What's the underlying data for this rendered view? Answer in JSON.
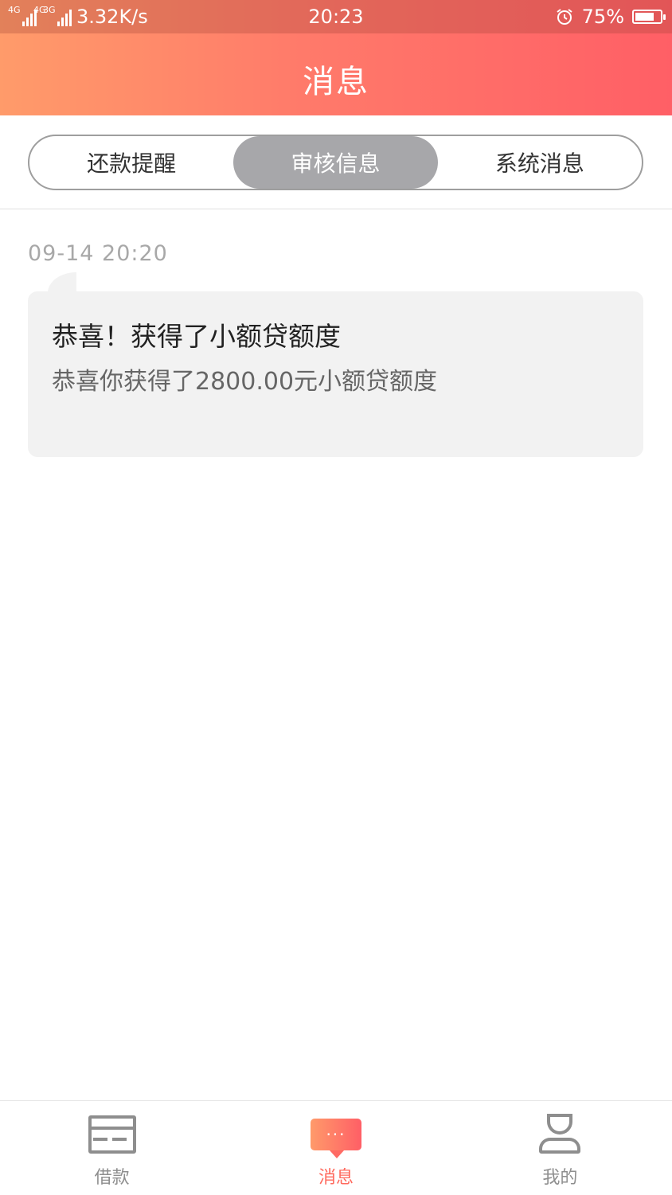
{
  "status_bar": {
    "network_1": "4G",
    "network_2": "4G",
    "network_3": "3G",
    "speed": "3.32K/s",
    "time": "20:23",
    "alarm_icon": "alarm-clock-icon",
    "battery": "75%",
    "battery_level": 0.75
  },
  "header": {
    "title": "消息"
  },
  "tabs": [
    {
      "label": "还款提醒",
      "active": false
    },
    {
      "label": "审核信息",
      "active": true
    },
    {
      "label": "系统消息",
      "active": false
    }
  ],
  "messages": [
    {
      "timestamp": "09-14  20:20",
      "title": "恭喜！获得了小额贷额度",
      "body": "恭喜你获得了2800.00元小额贷额度"
    }
  ],
  "bottom_nav": [
    {
      "label": "借款",
      "icon": "wallet-icon",
      "active": false
    },
    {
      "label": "消息",
      "icon": "chat-bubble-icon",
      "active": true
    },
    {
      "label": "我的",
      "icon": "person-icon",
      "active": false
    }
  ],
  "colors": {
    "accent": "#ff6a5e",
    "header_start": "#ff9b6a",
    "header_end": "#ff5f66",
    "tab_active": "#a7a7aa"
  }
}
